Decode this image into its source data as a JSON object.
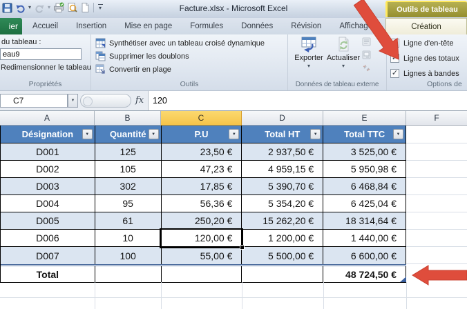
{
  "window": {
    "title": "Facture.xlsx - Microsoft Excel"
  },
  "icons": {
    "dropdown": "▾",
    "filter": "▼",
    "check": "✓",
    "namebox_dropdown": "▼"
  },
  "ribbon": {
    "file_tab_label": "ier",
    "tabs": [
      "Accueil",
      "Insertion",
      "Mise en page",
      "Formules",
      "Données",
      "Révision",
      "Affichage"
    ],
    "contextual_header": "Outils de tableau",
    "contextual_tab": "Création",
    "groups": {
      "proprietes": {
        "label": "Propriétés",
        "table_name_caption": "du tableau :",
        "table_name_value": "eau9",
        "resize_label": "Redimensionner le tableau"
      },
      "outils": {
        "label": "Outils",
        "items": [
          "Synthétiser avec un tableau croisé dynamique",
          "Supprimer les doublons",
          "Convertir en plage"
        ]
      },
      "donnees_externes": {
        "label": "Données de tableau externe",
        "export_label": "Exporter",
        "refresh_label": "Actualiser"
      },
      "options_style": {
        "label": "Options de",
        "checkboxes": [
          {
            "label": "Ligne d'en-tête",
            "checked": true
          },
          {
            "label": "Ligne des totaux",
            "checked": true
          },
          {
            "label": "Lignes à bandes",
            "checked": true
          }
        ]
      }
    }
  },
  "formula_bar": {
    "cell_ref": "C7",
    "fx_label": "fx",
    "value": "120"
  },
  "sheet": {
    "column_letters": [
      "A",
      "B",
      "C",
      "D",
      "E",
      "F"
    ],
    "selected_column": "C",
    "selected_cell": "C7"
  },
  "table": {
    "headers": [
      "Désignation",
      "Quantité",
      "P.U",
      "Total HT",
      "Total TTC"
    ],
    "rows": [
      [
        "D001",
        "125",
        "23,50 €",
        "2 937,50 €",
        "3 525,00 €"
      ],
      [
        "D002",
        "105",
        "47,23 €",
        "4 959,15 €",
        "5 950,98 €"
      ],
      [
        "D003",
        "302",
        "17,85 €",
        "5 390,70 €",
        "6 468,84 €"
      ],
      [
        "D004",
        "95",
        "56,36 €",
        "5 354,20 €",
        "6 425,04 €"
      ],
      [
        "D005",
        "61",
        "250,20 €",
        "15 262,20 €",
        "18 314,64 €"
      ],
      [
        "D006",
        "10",
        "120,00 €",
        "1 200,00 €",
        "1 440,00 €"
      ],
      [
        "D007",
        "100",
        "55,00 €",
        "5 500,00 €",
        "6 600,00 €"
      ]
    ],
    "total_label": "Total",
    "total_value": "48 724,50 €"
  },
  "colors": {
    "table_header_blue": "#4f81bd",
    "banded_row_blue": "#dbe5f1",
    "selected_column_header": "#f9d26a",
    "contextual_tab_olive": "#a49e3e",
    "annotation_arrow_red": "#df4d3c"
  }
}
